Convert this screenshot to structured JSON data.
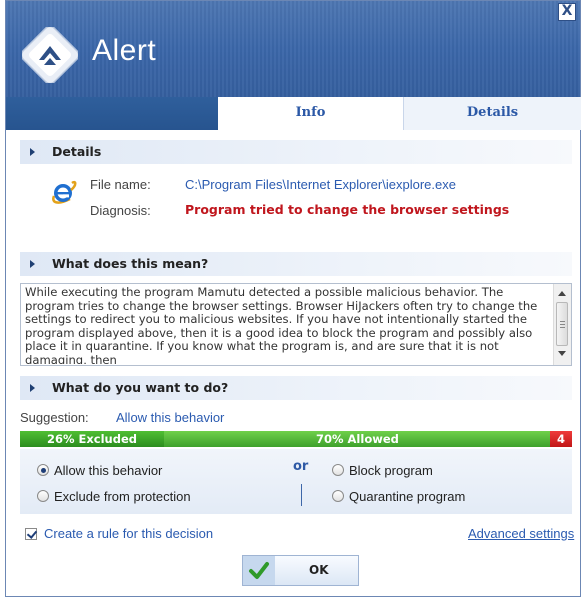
{
  "window": {
    "title": "Alert",
    "close_label": "X"
  },
  "tabs": [
    {
      "label": "Info",
      "active": true
    },
    {
      "label": "Details",
      "active": false
    }
  ],
  "details": {
    "header": "Details",
    "file_name_label": "File name:",
    "file_name_value": "C:\\Program Files\\Internet Explorer\\iexplore.exe",
    "diagnosis_label": "Diagnosis:",
    "diagnosis_value": "Program tried to change the browser settings"
  },
  "meaning": {
    "header": "What does this mean?",
    "text": "While executing the program Mamutu detected a possible malicious behavior. The program tries to change the browser settings. Browser HiJackers often try to change the settings to redirect you to malicious websites. If you have not intentionally started the program displayed above, then it is a good idea to block the program and possibly also place it in quarantine. If you know what the program is, and are sure that it is not damaging, then"
  },
  "action": {
    "header": "What do you want to do?",
    "suggestion_label": "Suggestion:",
    "suggestion_value": "Allow this behavior",
    "bar": {
      "excluded_label": "26% Excluded",
      "excluded_percent": 26,
      "allowed_label": "70% Allowed",
      "allowed_percent": 70,
      "blocked_label": "4",
      "blocked_percent": 4
    },
    "options": {
      "allow": "Allow this behavior",
      "exclude": "Exclude from protection",
      "or": "or",
      "block": "Block program",
      "quarantine": "Quarantine program",
      "selected": "allow"
    }
  },
  "footer": {
    "rule_label": "Create a rule for this decision",
    "rule_checked": true,
    "advanced_label": "Advanced settings",
    "ok_label": "OK"
  },
  "colors": {
    "header_blue": "#3b67a9",
    "link_blue": "#2b5bb0",
    "diagnosis_red": "#c0161d",
    "bar_green": "#3ea12c",
    "bar_red": "#c11616"
  }
}
